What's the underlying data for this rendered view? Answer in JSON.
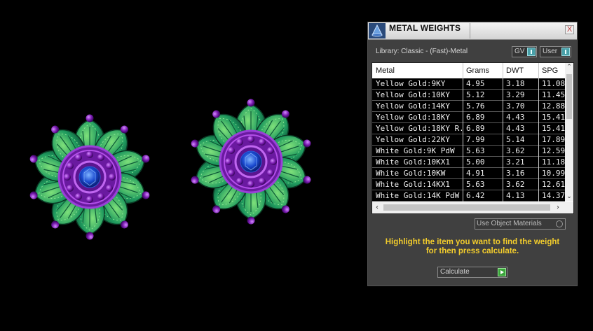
{
  "panel": {
    "title": "METAL WEIGHTS",
    "close_label": "X",
    "library_label": "Library: Classic - (Fast)-Metal",
    "toggle_gv": "GV",
    "toggle_user": "User",
    "columns": [
      "Metal",
      "Grams",
      "DWT",
      "SPG"
    ],
    "rows": [
      [
        "Yellow Gold:9KY",
        "4.95",
        "3.18",
        "11.08"
      ],
      [
        "Yellow Gold:10KY",
        "5.12",
        "3.29",
        "11.45"
      ],
      [
        "Yellow Gold:14KY",
        "5.76",
        "3.70",
        "12.88"
      ],
      [
        "Yellow Gold:18KY",
        "6.89",
        "4.43",
        "15.41"
      ],
      [
        "Yellow Gold:18KY R...",
        "6.89",
        "4.43",
        "15.41"
      ],
      [
        "Yellow Gold:22KY",
        "7.99",
        "5.14",
        "17.89"
      ],
      [
        "White Gold:9K PdW",
        "5.63",
        "3.62",
        "12.59"
      ],
      [
        "White Gold:10KX1",
        "5.00",
        "3.21",
        "11.18"
      ],
      [
        "White Gold:10KW",
        "4.91",
        "3.16",
        "10.99"
      ],
      [
        "White Gold:14KX1",
        "5.63",
        "3.62",
        "12.61"
      ],
      [
        "White Gold:14K PdW",
        "6.42",
        "4.13",
        "14.37"
      ]
    ],
    "use_object_materials": "Use Object Materials",
    "hint_line1": "Highlight the item you want to find the weight",
    "hint_line2": "for then press calculate.",
    "calculate_label": "Calculate"
  },
  "colors": {
    "accent_hint": "#f2cc2c",
    "toggle_teal": "#49a0a8",
    "calc_green": "#3aa53a",
    "petal_green": "#1e8a55",
    "bead_purple": "#7a1bb0",
    "gem_blue": "#1a4ad0"
  },
  "icons": {
    "app_logo": "cone-logo-icon",
    "close": "close-icon",
    "toggle": "toggle-switch-icon",
    "calculate": "play-arrow-icon",
    "scroll": "chevron-icon"
  }
}
